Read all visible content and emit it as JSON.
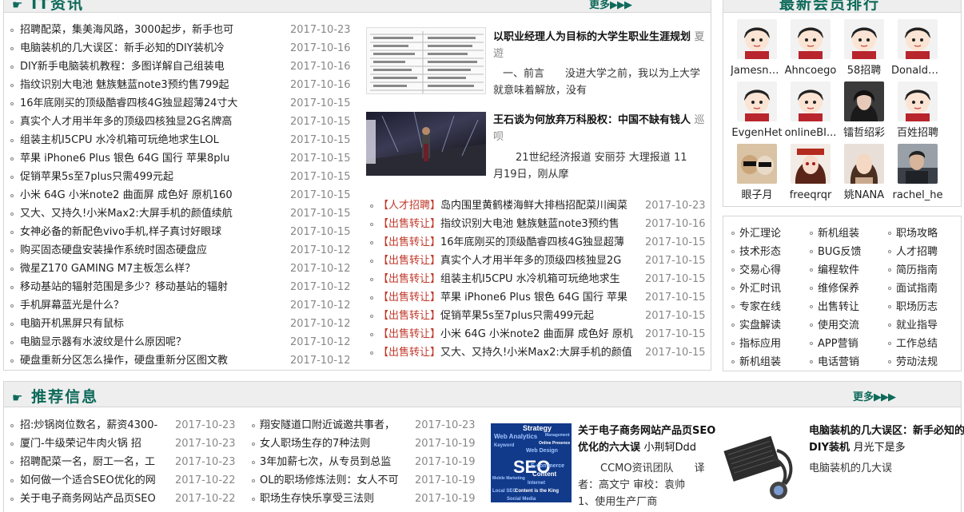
{
  "it_news": {
    "title": "IT资讯",
    "more": "更多",
    "items": [
      {
        "title": "招聘配菜，集美海风路，3000起步，新手也可",
        "date": "2017-10-23"
      },
      {
        "title": "电脑装机的几大误区：新手必知的DIY装机冷",
        "date": "2017-10-16"
      },
      {
        "title": "DIY新手电脑装机教程：多图详解自己组装电",
        "date": "2017-10-16"
      },
      {
        "title": "指纹识别大电池 魅族魅蓝note3预约售799起",
        "date": "2017-10-16"
      },
      {
        "title": "16年底刚买的顶级酷睿四核4G独显超薄24寸大",
        "date": "2017-10-15"
      },
      {
        "title": "真实个人才用半年多的顶级四核独显2G名牌高",
        "date": "2017-10-15"
      },
      {
        "title": "组装主机I5CPU 水冷机箱可玩绝地求生LOL",
        "date": "2017-10-15"
      },
      {
        "title": "苹果 iPhone6 Plus 银色 64G 国行 苹果8plu",
        "date": "2017-10-15"
      },
      {
        "title": "促销苹果5s至7plus只需499元起",
        "date": "2017-10-15"
      },
      {
        "title": "小米 64G 小米note2 曲面屏 成色好 原机160",
        "date": "2017-10-15"
      },
      {
        "title": "又大、又持久!小米Max2:大屏手机的颜值续航",
        "date": "2017-10-15"
      },
      {
        "title": "女神必备的新配色vivo手机,样子真讨好眼球",
        "date": "2017-10-15"
      },
      {
        "title": "购买固态硬盘安装操作系统时固态硬盘应",
        "date": "2017-10-12"
      },
      {
        "title": "微星Z170 GAMING M7主板怎么样？",
        "date": "2017-10-12"
      },
      {
        "title": "移动基站的辐射范围是多少？移动基站的辐射",
        "date": "2017-10-12"
      },
      {
        "title": "手机屏幕蓝光是什么？",
        "date": "2017-10-12"
      },
      {
        "title": "电脑开机黑屏只有鼠标",
        "date": "2017-10-12"
      },
      {
        "title": "电脑显示器有水波纹是什么原因呢？",
        "date": "2017-10-12"
      },
      {
        "title": "硬盘重新分区怎么操作，硬盘重新分区图文教",
        "date": "2017-10-12"
      }
    ],
    "featured": [
      {
        "title": "以职业经理人为目标的大学生职业生涯规划",
        "author": "夏遊",
        "summary": "一、前言　　没进大学之前，我以为上大学就意味着解放，没有"
      },
      {
        "title": "王石谈为何放弃万科股权：中国不缺有钱人",
        "author": "巡呗",
        "summary": "21世纪经济报道 安丽芬 大理报道 11月19日，刚从摩"
      }
    ],
    "sale_items": [
      {
        "tag": "【人才招聘】",
        "title": "岛内围里黄鹤楼海鲜大排档招配菜川闽菜",
        "date": "2017-10-23"
      },
      {
        "tag": "【出售转让】",
        "title": "指纹识别大电池 魅族魅蓝note3预约售",
        "date": "2017-10-16"
      },
      {
        "tag": "【出售转让】",
        "title": "16年底刚买的顶级酷睿四核4G独显超薄",
        "date": "2017-10-15"
      },
      {
        "tag": "【出售转让】",
        "title": "真实个人才用半年多的顶级四核独显2G",
        "date": "2017-10-15"
      },
      {
        "tag": "【出售转让】",
        "title": "组装主机I5CPU 水冷机箱可玩绝地求生",
        "date": "2017-10-15"
      },
      {
        "tag": "【出售转让】",
        "title": "苹果 iPhone6 Plus 银色 64G 国行 苹果",
        "date": "2017-10-15"
      },
      {
        "tag": "【出售转让】",
        "title": "促销苹果5s至7plus只需499元起",
        "date": "2017-10-15"
      },
      {
        "tag": "【出售转让】",
        "title": "小米 64G 小米note2 曲面屏 成色好 原机",
        "date": "2017-10-15"
      },
      {
        "tag": "【出售转让】",
        "title": "又大、又持久!小米Max2:大屏手机的颜值",
        "date": "2017-10-15"
      }
    ]
  },
  "members": {
    "title": "最新会员排行",
    "items": [
      {
        "name": "Jamesne..."
      },
      {
        "name": "Ahncoego"
      },
      {
        "name": "58招聘"
      },
      {
        "name": "DonaldBok"
      },
      {
        "name": "EvgenHet"
      },
      {
        "name": "onlineBI..."
      },
      {
        "name": "镭哲绍彩"
      },
      {
        "name": "百姓招聘"
      },
      {
        "name": "眼子月"
      },
      {
        "name": "freeqrqr"
      },
      {
        "name": "姚NANA"
      },
      {
        "name": "rachel_he"
      }
    ]
  },
  "categories": [
    [
      "外汇理论",
      "新机组装",
      "职场攻略"
    ],
    [
      "技术形态",
      "BUG反馈",
      "人才招聘"
    ],
    [
      "交易心得",
      "编程软件",
      "简历指南"
    ],
    [
      "外汇时讯",
      "维修保养",
      "面试指南"
    ],
    [
      "专家在线",
      "出售转让",
      "职场历志"
    ],
    [
      "实盘解读",
      "使用交流",
      "就业指导"
    ],
    [
      "指标应用",
      "APP营销",
      "工作总结"
    ],
    [
      "新机组装",
      "电话营销",
      "劳动法规"
    ]
  ],
  "recommend": {
    "title": "推荐信息",
    "more": "更多",
    "col1": [
      {
        "title": "招:炒锅岗位数名，薪资4300-",
        "date": "2017-10-23"
      },
      {
        "title": "厦门-牛级荣记牛肉火锅 招",
        "date": "2017-10-23"
      },
      {
        "title": "招聘配菜一名，厨工一名，工",
        "date": "2017-10-23"
      },
      {
        "title": "如何做一个适合SEO优化的网",
        "date": "2017-10-22"
      },
      {
        "title": "关于电子商务网站产品页SEO",
        "date": "2017-10-22"
      }
    ],
    "col2": [
      {
        "title": "翔安隧道口附近诚邀共事者，",
        "date": "2017-10-23"
      },
      {
        "title": "女人职场生存的7种法则",
        "date": "2017-10-19"
      },
      {
        "title": "3年加薪七次，从专员到总监",
        "date": "2017-10-19"
      },
      {
        "title": "OL的职场修炼法则：女人不可",
        "date": "2017-10-19"
      },
      {
        "title": "职场生存快乐享受三法则",
        "date": "2017-10-19"
      }
    ],
    "featured": [
      {
        "title": "关于电子商务网站产品页SEO优化的六大误",
        "author": "小荆轲Ddd",
        "summary": "CCMO资讯团队　　译者：高文宁 审校：袁帅　　1、使用生产厂商"
      },
      {
        "title": "电脑装机的几大误区：新手必知的DIY装机",
        "author": "月光下是多",
        "summary": "电脑装机的几大误"
      }
    ],
    "seo_thumb_words": [
      "Strategy",
      "Management",
      "Web Analytics",
      "Online Presence",
      "Keyword",
      "Web Design",
      "SEO",
      "Mobile Marketing",
      "E-commerce",
      "Content",
      "Internet",
      "Local SEO",
      "Content is the King",
      "Social Media"
    ]
  }
}
